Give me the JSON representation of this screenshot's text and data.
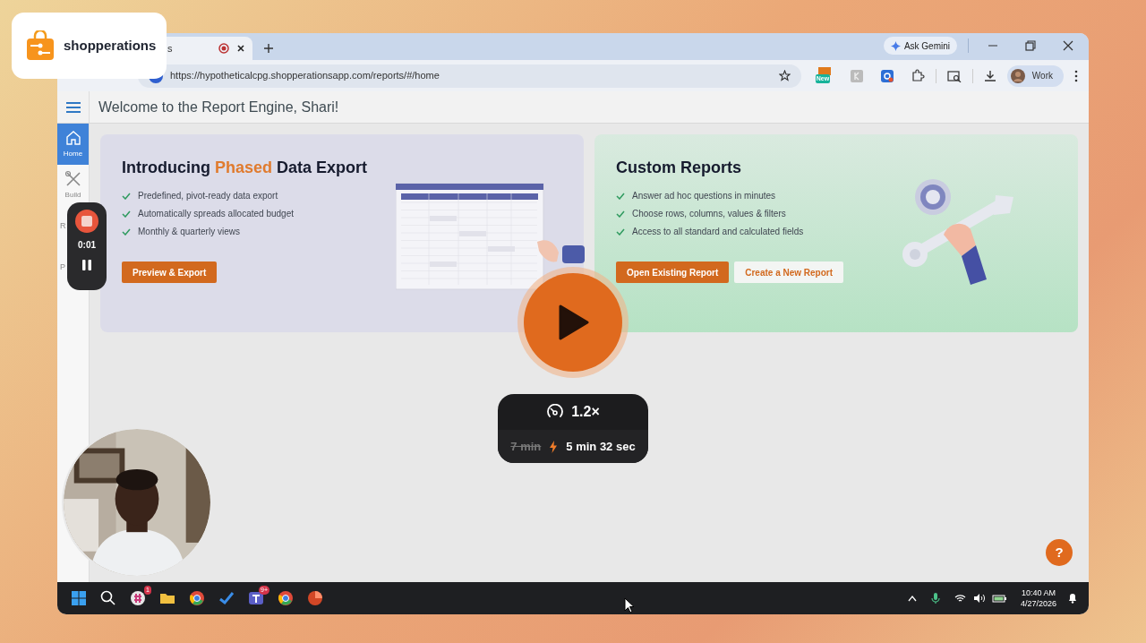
{
  "brand": {
    "name": "shopperations"
  },
  "browser": {
    "tab": {
      "title": "s",
      "recording": true
    },
    "ask_button": "Ask Gemini",
    "url": "https://hypotheticalcpg.shopperationsapp.com/reports/#/home",
    "extension_badge": "New",
    "profile": "Work"
  },
  "app": {
    "header": "Welcome to the Report Engine, Shari!",
    "sidebar": [
      {
        "label": "Home",
        "selected": true
      },
      {
        "label": "Build",
        "selected": false
      },
      {
        "label": "R",
        "selected": false
      },
      {
        "label": "P",
        "selected": false
      }
    ],
    "cards": [
      {
        "kind": "phased",
        "title_start": "Introducing",
        "title_highlight": "Phased",
        "title_end": "Data Export",
        "features": [
          "Predefined, pivot-ready data export",
          "Automatically spreads allocated budget",
          "Monthly & quarterly views"
        ],
        "buttons": [
          {
            "label": "Preview & Export",
            "primary": true
          }
        ]
      },
      {
        "kind": "custom",
        "title_start": "Custom Reports",
        "features": [
          "Answer ad hoc questions in minutes",
          "Choose rows, columns, values & filters",
          "Access to all standard and calculated fields"
        ],
        "buttons": [
          {
            "label": "Open Existing Report",
            "primary": true
          },
          {
            "label": "Create a New Report",
            "primary": false
          }
        ]
      }
    ],
    "help": "?"
  },
  "taskbar": {
    "badges": [
      "1",
      "9+"
    ],
    "time": "10:40 AM",
    "date": "4/27/2026"
  },
  "player": {
    "recorder": {
      "time": "0:01",
      "recording": true
    },
    "speed": "1.2×",
    "original_duration": "7 min",
    "duration": "5 min 32 sec"
  }
}
